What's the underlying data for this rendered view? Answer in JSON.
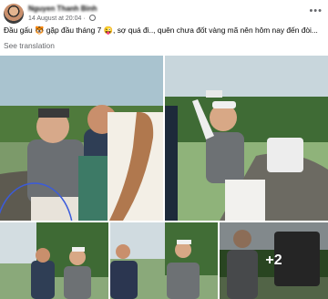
{
  "post": {
    "author_name": "Nguyen Thanh Binh",
    "timestamp": "14 August at 20:04",
    "separator": "·",
    "caption": "Đầu gấu 🐯 gặp đầu tháng 7 😜, sợ quá đi.., quên chưa đốt vàng mã nên hôm nay đến đòi...",
    "see_translation": "See translation",
    "more_icon": "more-options-icon"
  },
  "gallery": {
    "extra_count": "+2",
    "photos": [
      {
        "name": "golf-course-group-photo",
        "desc": "men in golf attire on course"
      },
      {
        "name": "golf-player-pointing-photo"
      },
      {
        "name": "golf-thumb-1"
      },
      {
        "name": "golf-thumb-2"
      },
      {
        "name": "golf-thumb-3"
      }
    ]
  },
  "colors": {
    "meta_text": "#65676b",
    "primary_text": "#050505",
    "highlight_circle": "#3b5bdb"
  }
}
